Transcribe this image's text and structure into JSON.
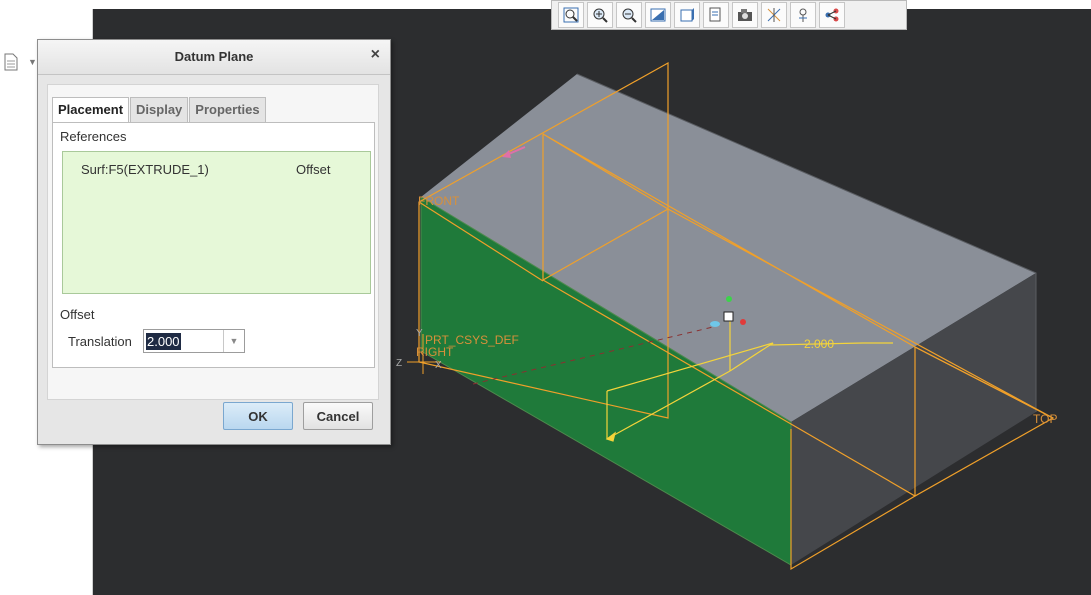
{
  "dialog": {
    "title": "Datum Plane",
    "close_glyph": "×",
    "tabs": [
      {
        "label": "Placement",
        "active": true
      },
      {
        "label": "Display",
        "active": false
      },
      {
        "label": "Properties",
        "active": false
      }
    ],
    "references_label": "References",
    "reference": {
      "surface": "Surf:F5(EXTRUDE_1)",
      "type": "Offset"
    },
    "offset_label": "Offset",
    "translation_label": "Translation",
    "translation_value": "2.000",
    "ok_label": "OK",
    "cancel_label": "Cancel"
  },
  "viewport": {
    "labels": {
      "front": "FRONT",
      "csys": "PRT_CSYS_DEF",
      "right": "RIGHT",
      "top": "TOP",
      "dimension": "2.000",
      "axis_y": "Y",
      "axis_z": "Z",
      "axis_x": "X"
    },
    "colors": {
      "background": "#2c2d2f",
      "top_face": "#8a8f98",
      "side_face": "#4a4c50",
      "selected_face": "#1f7a3a",
      "datum_orange": "#f0a02a",
      "dimension_yellow": "#f4d43a"
    }
  },
  "toolbar": {
    "buttons": [
      {
        "icon": "zoom-fit-icon"
      },
      {
        "icon": "zoom-in-icon"
      },
      {
        "icon": "zoom-out-icon"
      },
      {
        "icon": "repaint-icon"
      },
      {
        "icon": "display-style-icon"
      },
      {
        "icon": "saved-orientations-icon"
      },
      {
        "icon": "view-manager-icon"
      },
      {
        "icon": "datum-display-icon"
      },
      {
        "icon": "annotation-display-icon"
      },
      {
        "icon": "spin-center-icon"
      }
    ]
  }
}
